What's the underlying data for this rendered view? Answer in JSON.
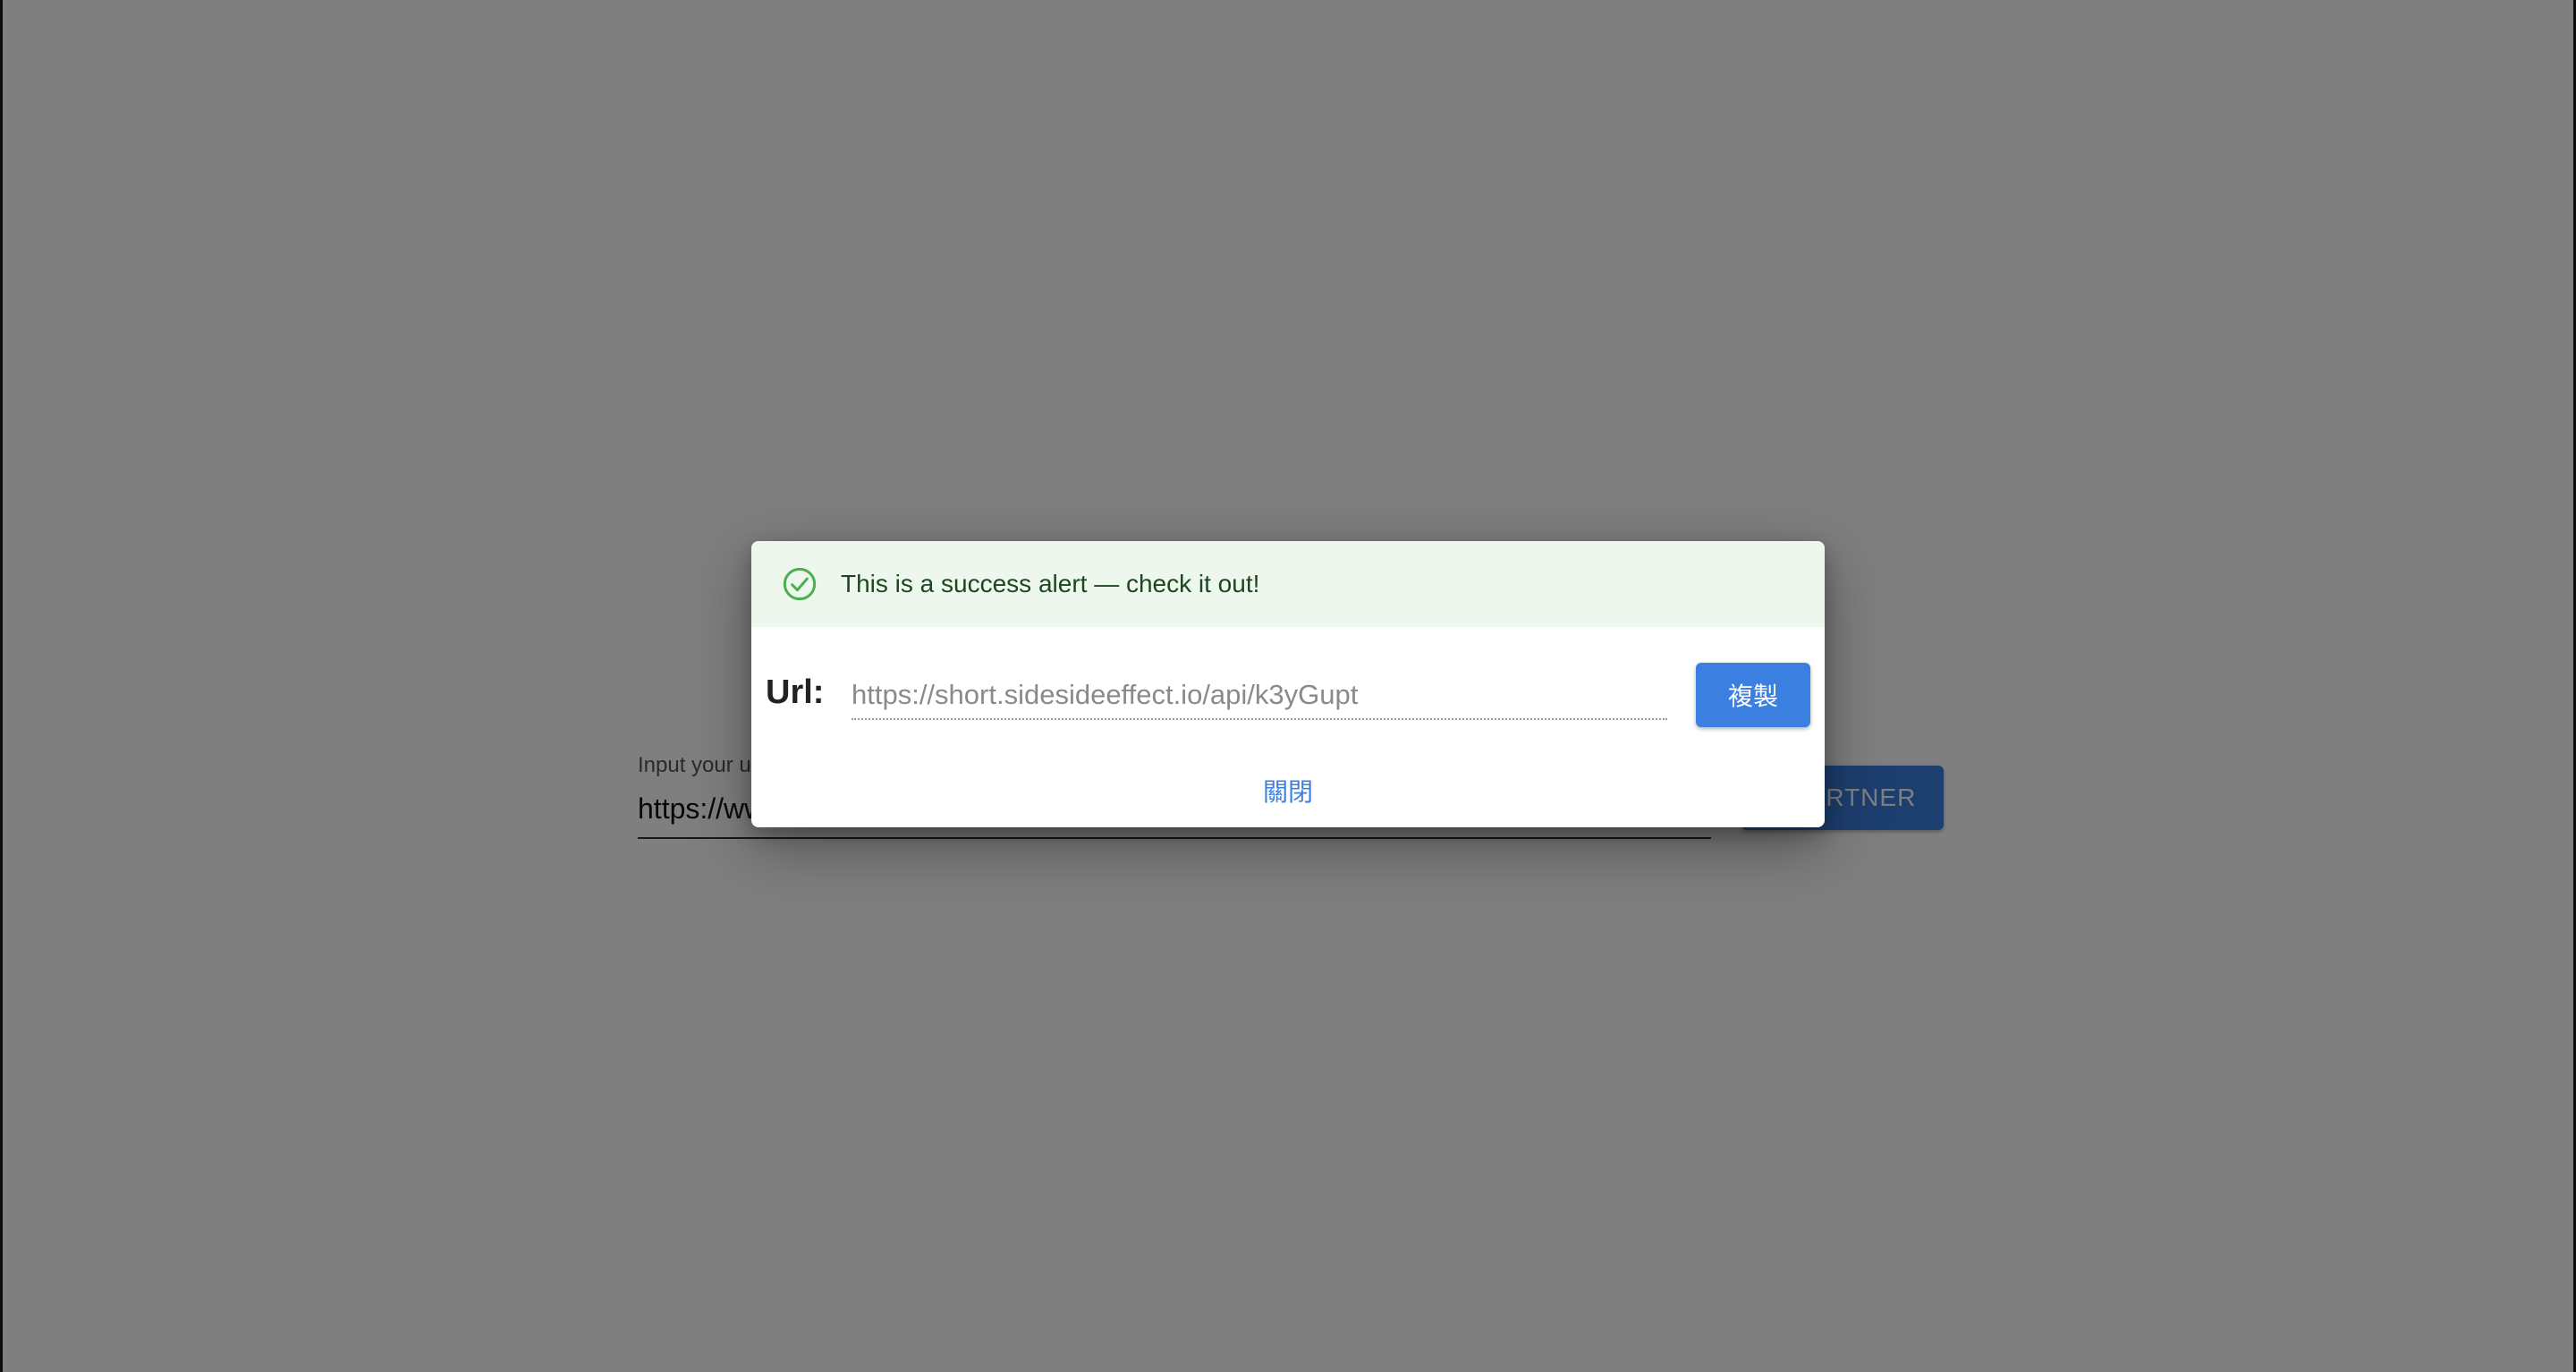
{
  "page": {
    "input_label": "Input your url",
    "input_value": "https://www.example.com",
    "shorten_button_label": "SHORTNER"
  },
  "dialog": {
    "alert_text": "This is a success alert — check it out!",
    "alert_icon": "check-circle-icon",
    "url_label": "Url:",
    "url_placeholder": "https://short.sidesideeffect.io/api/k3yGupt",
    "copy_button_label": "複製",
    "close_button_label": "關閉"
  },
  "colors": {
    "primary": "#3b7fe0",
    "success_bg": "#edf7ed",
    "success_icon": "#4caf50",
    "success_text": "#1e4620",
    "backdrop": "rgba(0,0,0,0.5)"
  }
}
